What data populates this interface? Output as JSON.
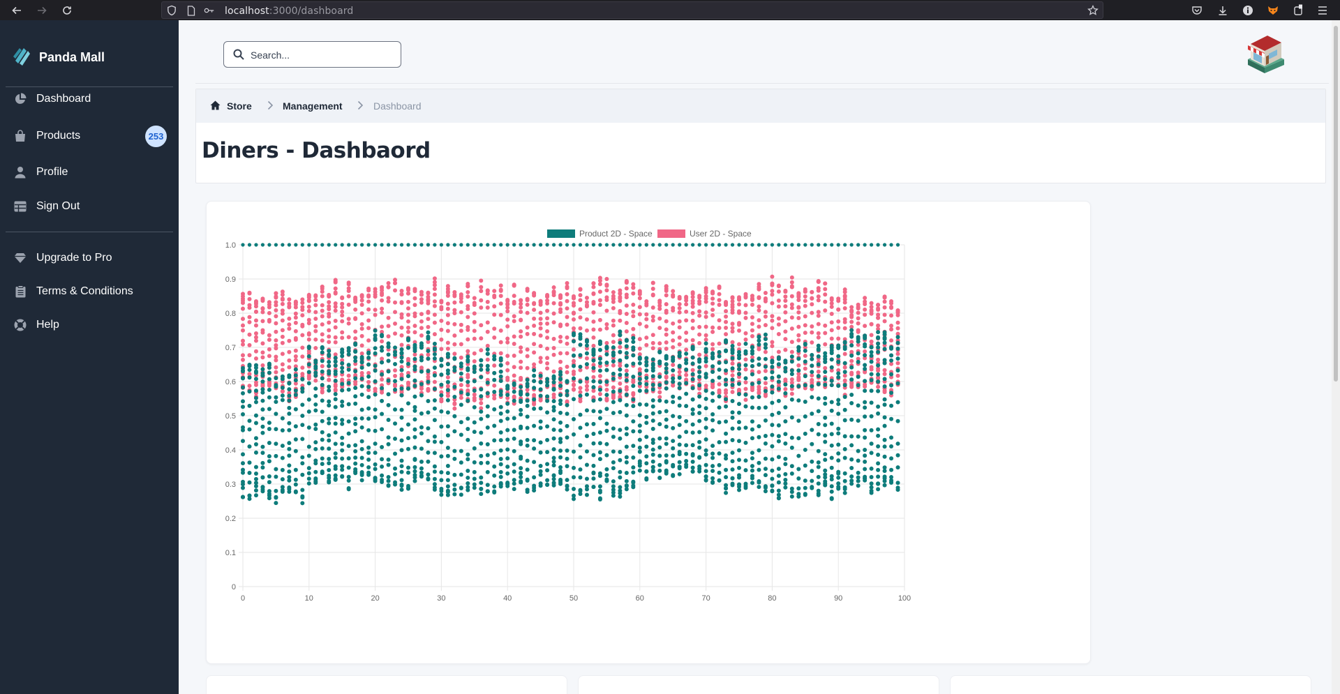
{
  "browser": {
    "url_host": "localhost",
    "url_path": ":3000/dashboard"
  },
  "sidebar": {
    "brand": "Panda Mall",
    "items": [
      {
        "label": "Dashboard",
        "icon": "chart-pie-icon"
      },
      {
        "label": "Products",
        "icon": "shopping-bag-icon",
        "badge": "253"
      },
      {
        "label": "Profile",
        "icon": "user-icon"
      },
      {
        "label": "Sign Out",
        "icon": "table-icon"
      }
    ],
    "secondary_items": [
      {
        "label": "Upgrade to Pro",
        "icon": "gem-icon"
      },
      {
        "label": "Terms & Conditions",
        "icon": "clipboard-icon"
      },
      {
        "label": "Help",
        "icon": "life-ring-icon"
      }
    ]
  },
  "header": {
    "search_placeholder": "Search..."
  },
  "breadcrumb": {
    "items": [
      "Store",
      "Management",
      "Dashboard"
    ]
  },
  "page": {
    "title": "Diners - Dashbaord"
  },
  "colors": {
    "sidebar_bg": "#1f2937",
    "product_series": "#0e7c7b",
    "user_series": "#f06786",
    "badge_bg": "#cfe3ff",
    "badge_text": "#1e62d0"
  },
  "chart_data": {
    "type": "scatter",
    "title": "",
    "xlabel": "",
    "ylabel": "",
    "xlim": [
      0,
      100
    ],
    "ylim": [
      0,
      1
    ],
    "x_ticks": [
      "0",
      "10",
      "20",
      "30",
      "40",
      "50",
      "60",
      "70",
      "80",
      "90",
      "100"
    ],
    "y_ticks": [
      "0",
      "0.1",
      "0.2",
      "0.3",
      "0.4",
      "0.5",
      "0.6",
      "0.7",
      "0.8",
      "0.9",
      "1.0"
    ],
    "grid": true,
    "legend_position": "top-center",
    "series": [
      {
        "name": "Product 2D - Space",
        "color": "#0e7c7b",
        "constant_y": 1.0,
        "x_range": [
          0,
          99
        ],
        "column_range_by_block": [
          {
            "x_from": 0,
            "x_to": 9,
            "y_min": 0.25,
            "y_max": 0.66
          },
          {
            "x_from": 10,
            "x_to": 19,
            "y_min": 0.29,
            "y_max": 0.71
          },
          {
            "x_from": 20,
            "x_to": 29,
            "y_min": 0.28,
            "y_max": 0.75
          },
          {
            "x_from": 30,
            "x_to": 39,
            "y_min": 0.26,
            "y_max": 0.69
          },
          {
            "x_from": 40,
            "x_to": 49,
            "y_min": 0.27,
            "y_max": 0.63
          },
          {
            "x_from": 50,
            "x_to": 59,
            "y_min": 0.26,
            "y_max": 0.75
          },
          {
            "x_from": 60,
            "x_to": 69,
            "y_min": 0.31,
            "y_max": 0.71
          },
          {
            "x_from": 70,
            "x_to": 79,
            "y_min": 0.28,
            "y_max": 0.74
          },
          {
            "x_from": 80,
            "x_to": 89,
            "y_min": 0.26,
            "y_max": 0.71
          },
          {
            "x_from": 90,
            "x_to": 99,
            "y_min": 0.27,
            "y_max": 0.75
          }
        ]
      },
      {
        "name": "User 2D - Space",
        "color": "#f06786",
        "x_range": [
          0,
          99
        ],
        "column_range_by_block": [
          {
            "x_from": 0,
            "x_to": 9,
            "y_min": 0.55,
            "y_max": 0.87
          },
          {
            "x_from": 10,
            "x_to": 19,
            "y_min": 0.57,
            "y_max": 0.9
          },
          {
            "x_from": 20,
            "x_to": 29,
            "y_min": 0.56,
            "y_max": 0.9
          },
          {
            "x_from": 30,
            "x_to": 39,
            "y_min": 0.53,
            "y_max": 0.89
          },
          {
            "x_from": 40,
            "x_to": 49,
            "y_min": 0.53,
            "y_max": 0.89
          },
          {
            "x_from": 50,
            "x_to": 59,
            "y_min": 0.54,
            "y_max": 0.9
          },
          {
            "x_from": 60,
            "x_to": 69,
            "y_min": 0.56,
            "y_max": 0.89
          },
          {
            "x_from": 70,
            "x_to": 79,
            "y_min": 0.55,
            "y_max": 0.88
          },
          {
            "x_from": 80,
            "x_to": 89,
            "y_min": 0.56,
            "y_max": 0.9
          },
          {
            "x_from": 90,
            "x_to": 99,
            "y_min": 0.56,
            "y_max": 0.87
          }
        ]
      }
    ]
  }
}
